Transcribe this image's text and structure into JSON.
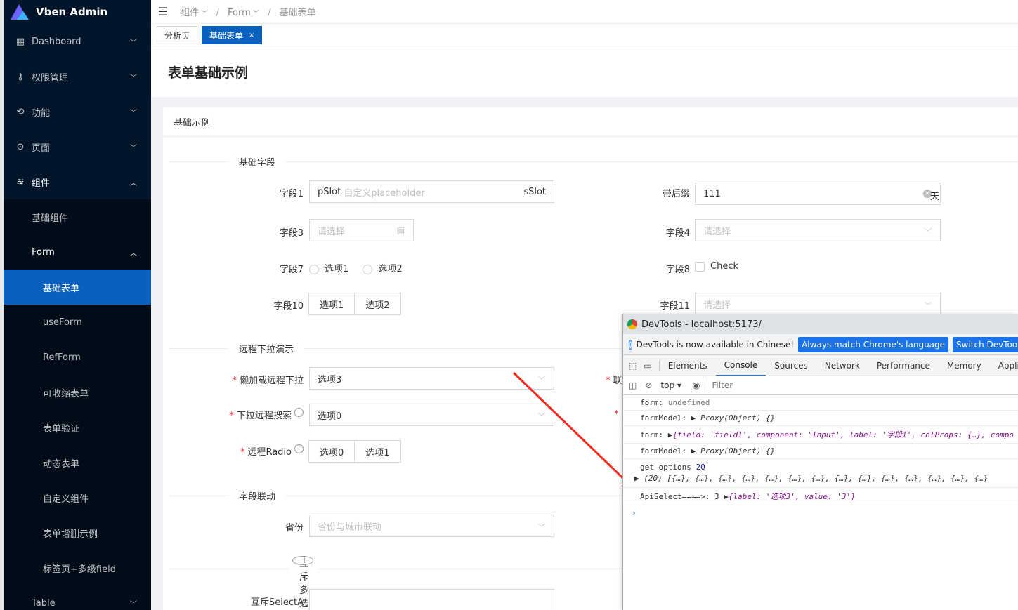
{
  "app": {
    "title": "Vben Admin"
  },
  "sidebar": {
    "items": [
      {
        "label": "Dashboard",
        "icon": "grid-icon"
      },
      {
        "label": "权限管理",
        "icon": "key-icon"
      },
      {
        "label": "功能",
        "icon": "tool-icon"
      },
      {
        "label": "页面",
        "icon": "page-icon"
      },
      {
        "label": "组件",
        "icon": "layers-icon"
      }
    ],
    "components_sub": [
      {
        "label": "基础组件"
      },
      {
        "label": "Form"
      }
    ],
    "form_sub": [
      "基础表单",
      "useForm",
      "RefForm",
      "可收缩表单",
      "表单验证",
      "动态表单",
      "自定义组件",
      "表单增删示例",
      "标签页+多级field"
    ],
    "table_label": "Table"
  },
  "breadcrumb": [
    "组件",
    "Form",
    "基础表单"
  ],
  "tabs": [
    {
      "label": "分析页"
    },
    {
      "label": "基础表单",
      "close": "×"
    }
  ],
  "page": {
    "title": "表单基础示例",
    "card_title": "基础示例"
  },
  "form": {
    "section1": "基础字段",
    "field1": {
      "label": "字段1",
      "prefix": "pSlot",
      "placeholder": "自定义placeholder",
      "suffix": "sSlot"
    },
    "suffix_field": {
      "label": "带后缀",
      "value": "111",
      "addon": "天"
    },
    "field3": {
      "label": "字段3",
      "placeholder": "请选择"
    },
    "field4": {
      "label": "字段4",
      "placeholder": "请选择"
    },
    "field7": {
      "label": "字段7",
      "options": [
        "选项1",
        "选项2"
      ]
    },
    "field8": {
      "label": "字段8",
      "option": "Check"
    },
    "field10": {
      "label": "字段10",
      "options": [
        "选项1",
        "选项2"
      ]
    },
    "field11": {
      "label": "字段11",
      "placeholder": "请选择"
    },
    "section2": "远程下拉演示",
    "lazy_select": {
      "label": "懒加载远程下拉",
      "value": "选项3"
    },
    "remote_search": {
      "label": "下拉远程搜索",
      "value": "选项0"
    },
    "remote_radio": {
      "label": "远程Radio",
      "options": [
        "选项0",
        "选项1"
      ]
    },
    "right_trunc_label": "联",
    "section3": "字段联动",
    "province": {
      "label": "省份",
      "placeholder": "省份与城市联动"
    },
    "section4": "互斥多选",
    "mutex_a": {
      "label": "互斥SelectA"
    }
  },
  "devtools": {
    "title": "DevTools - localhost:5173/",
    "banner": "DevTools is now available in Chinese!",
    "btn1": "Always match Chrome's language",
    "btn2": "Switch DevTools to Chine",
    "tabs": [
      "Elements",
      "Console",
      "Sources",
      "Network",
      "Performance",
      "Memory",
      "Applicatio"
    ],
    "context": "top",
    "filter_placeholder": "Filter",
    "logs": {
      "l1a": "form:",
      "l1b": "undefined",
      "l2a": "formModel:",
      "l2b": "Proxy(Object) {}",
      "l3a": "form:",
      "l3b": "{field: 'field1', component: 'Input', label: '字段1', colProps: {…}, compo",
      "l4a": "formModel:",
      "l4b": "Proxy(Object) {}",
      "l5a": "get options",
      "l5b": "20",
      "l6": "(20) [{…}, {…}, {…}, {…}, {…}, {…}, {…}, {…}, {…}, {…}, {…}, {…}, {…}, {…}",
      "l7a": "ApiSelect====>: 3",
      "l7b": "{label: '选项3', value: '3'}"
    }
  },
  "colors": {
    "sidebar": "#001529",
    "active": "#0960bd",
    "arrow": "#f02b1f"
  }
}
